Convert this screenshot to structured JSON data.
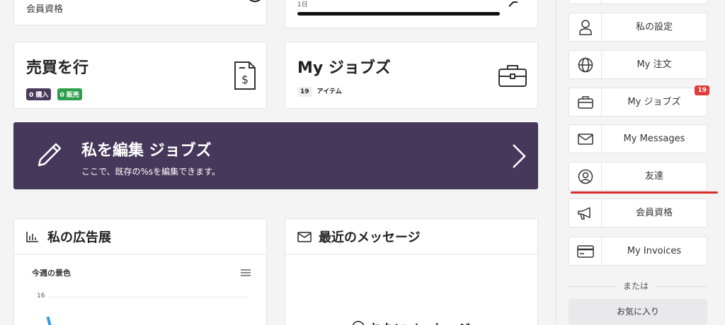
{
  "cards": {
    "membership": {
      "label": "会員資格"
    },
    "progress": {
      "label": "1日"
    },
    "trade": {
      "title": "売買を行",
      "badges": [
        {
          "text": "0 購入",
          "color": "#4a3b5c"
        },
        {
          "text": "0 販売",
          "color": "#2e9e4f"
        }
      ]
    },
    "jobs": {
      "title": "My ジョブズ",
      "count": "19",
      "count_label": "アイテム"
    }
  },
  "banner": {
    "title": "私を編集 ジョブズ",
    "subtitle": "ここで、既存の%sを編集できます。",
    "color": "#45385a"
  },
  "ads": {
    "title": "私の広告展",
    "chart_title": "今週の景色",
    "tick": "16"
  },
  "messages": {
    "title": "最近のメッセージ",
    "empty": "おないメッセージ"
  },
  "sidebar": {
    "items": [
      {
        "label": "私の設定",
        "icon": "user-icon"
      },
      {
        "label": "My 注文",
        "icon": "globe-icon"
      },
      {
        "label": "My ジョブズ",
        "icon": "briefcase-icon",
        "badge": "19"
      },
      {
        "label": "My Messages",
        "icon": "envelope-icon"
      },
      {
        "label": "友達",
        "icon": "user-circle-icon"
      },
      {
        "label": "会員資格",
        "icon": "megaphone-icon"
      },
      {
        "label": "My Invoices",
        "icon": "credit-card-icon"
      }
    ],
    "divider_text": "または",
    "favorites_label": "お気に入り"
  },
  "colors": {
    "accent": "#45385a",
    "underline": "#d62c2c",
    "badge_red": "#e03c3c"
  }
}
